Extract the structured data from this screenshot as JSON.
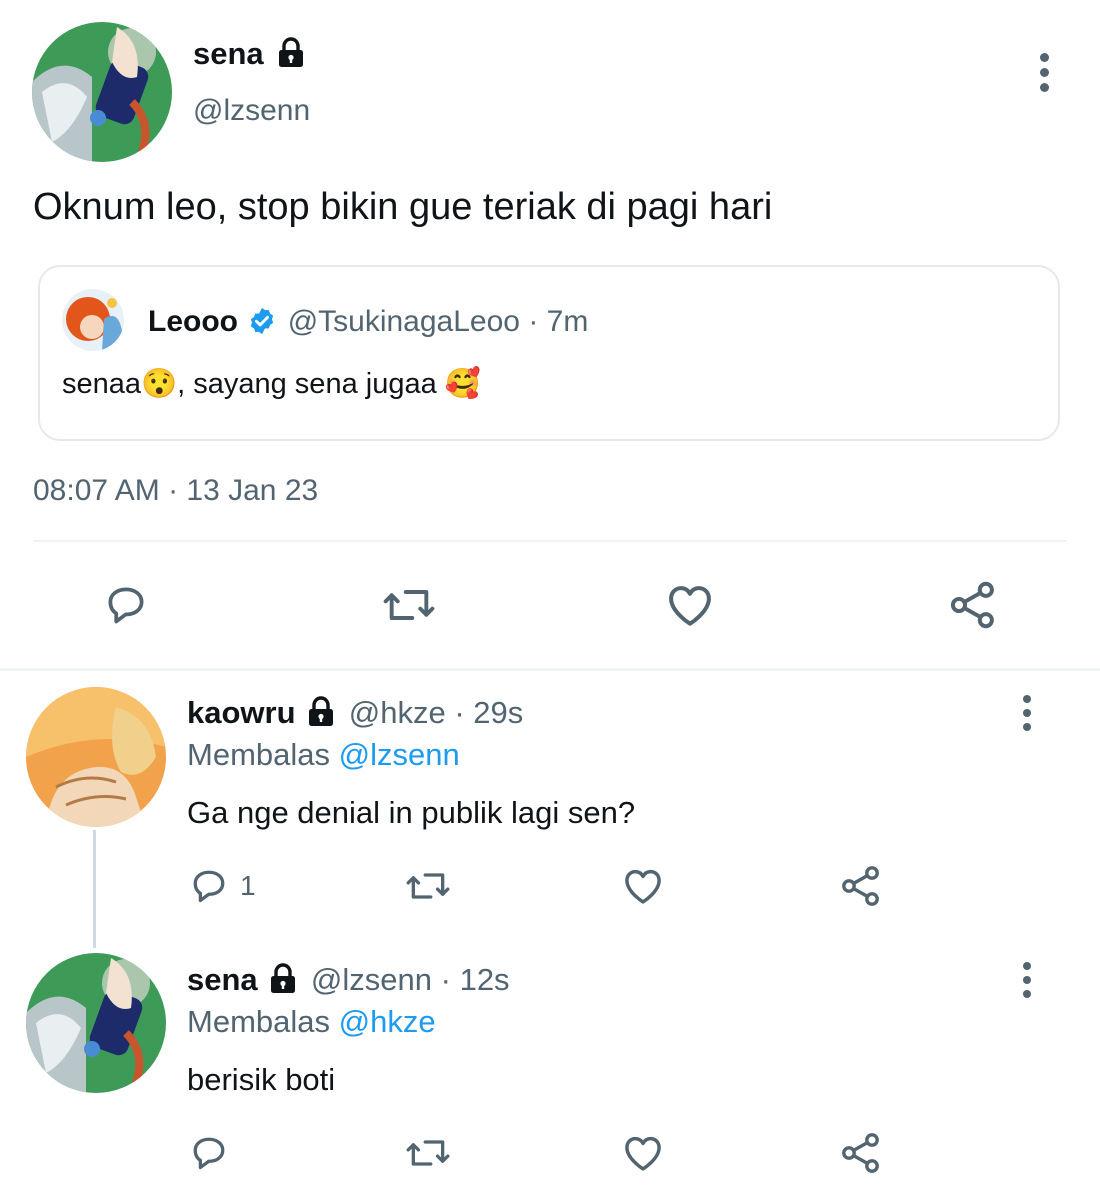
{
  "main_tweet": {
    "display_name": "sena",
    "handle": "@lzsenn",
    "text": "Oknum leo, stop bikin gue teriak di pagi hari",
    "timestamp": "08:07 AM · 13 Jan 23",
    "quote": {
      "display_name": "Leooo",
      "handle": "@TsukinagaLeoo",
      "age": "· 7m",
      "text_part1": "senaa",
      "emoji1": "😯",
      "text_part2": ", sayang sena jugaa ",
      "emoji2": "🥰"
    }
  },
  "replies": [
    {
      "display_name": "kaowru",
      "handle": "@hkze",
      "age": "· 29s",
      "replying_prefix": "Membalas",
      "replying_to": "@lzsenn",
      "text": "Ga nge denial in publik lagi sen?",
      "reply_count": "1"
    },
    {
      "display_name": "sena",
      "handle": "@lzsenn",
      "age": "· 12s",
      "replying_prefix": "Membalas",
      "replying_to": "@hkze",
      "text": "berisik boti",
      "reply_count": ""
    }
  ],
  "icons": {
    "reply": "reply-icon",
    "retweet": "retweet-icon",
    "like": "heart-icon",
    "share": "share-icon",
    "more": "more-icon",
    "lock": "lock-icon",
    "verified": "verified-badge-icon"
  },
  "colors": {
    "text": "#0f1419",
    "muted": "#536471",
    "accent": "#1d9bf0",
    "divider": "#eff3f4"
  }
}
